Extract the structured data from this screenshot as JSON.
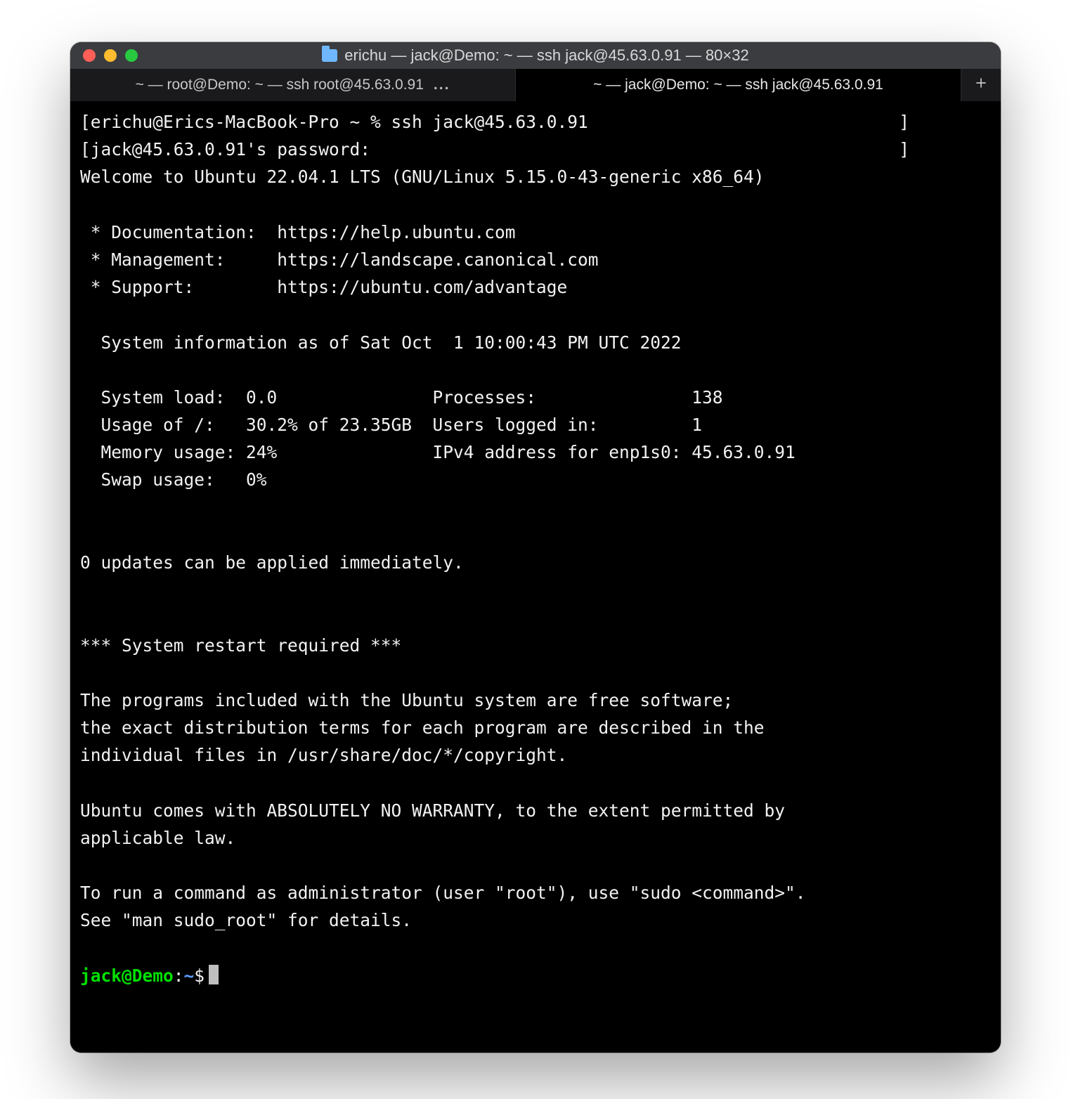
{
  "window": {
    "title": "erichu — jack@Demo: ~ — ssh jack@45.63.0.91 — 80×32"
  },
  "tabs": {
    "inactive_full": "~ — root@Demo: ~ — ssh root@45.63.0.91",
    "inactive_ellipsis": "...",
    "active": "~ — jack@Demo: ~ — ssh jack@45.63.0.91"
  },
  "body": {
    "l1": "[erichu@Erics-MacBook-Pro ~ % ssh jack@45.63.0.91                              ]",
    "l2": "[jack@45.63.0.91's password:                                                   ]",
    "l3": "Welcome to Ubuntu 22.04.1 LTS (GNU/Linux 5.15.0-43-generic x86_64)",
    "l4": "",
    "l5": " * Documentation:  https://help.ubuntu.com",
    "l6": " * Management:     https://landscape.canonical.com",
    "l7": " * Support:        https://ubuntu.com/advantage",
    "l8": "",
    "l9": "  System information as of Sat Oct  1 10:00:43 PM UTC 2022",
    "l10": "",
    "l11": "  System load:  0.0               Processes:               138",
    "l12": "  Usage of /:   30.2% of 23.35GB  Users logged in:         1",
    "l13": "  Memory usage: 24%               IPv4 address for enp1s0: 45.63.0.91",
    "l14": "  Swap usage:   0%",
    "l15": "",
    "l16": "",
    "l17": "0 updates can be applied immediately.",
    "l18": "",
    "l19": "",
    "l20": "*** System restart required ***",
    "l21": "",
    "l22": "The programs included with the Ubuntu system are free software;",
    "l23": "the exact distribution terms for each program are described in the",
    "l24": "individual files in /usr/share/doc/*/copyright.",
    "l25": "",
    "l26": "Ubuntu comes with ABSOLUTELY NO WARRANTY, to the extent permitted by",
    "l27": "applicable law.",
    "l28": "",
    "l29": "To run a command as administrator (user \"root\"), use \"sudo <command>\".",
    "l30": "See \"man sudo_root\" for details.",
    "l31": ""
  },
  "prompt": {
    "user_host": "jack@Demo",
    "colon": ":",
    "path": "~",
    "dollar": "$"
  }
}
